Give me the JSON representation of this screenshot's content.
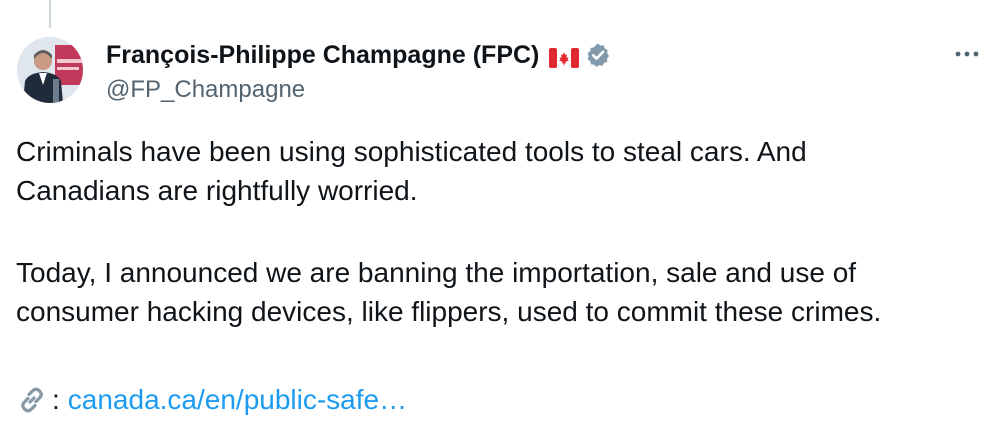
{
  "tweet": {
    "author": {
      "name": "François-Philippe Champagne (FPC)",
      "handle": "@FP_Champagne",
      "flag_icon": "canada-flag-icon",
      "verified_icon": "verified-badge-icon",
      "verified_color": "#829aab"
    },
    "more_icon": "more-horizontal-icon",
    "paragraph1_line1": "Criminals have been using sophisticated tools to steal cars. And",
    "paragraph1_line2": "Canadians are rightfully worried.",
    "paragraph2_line1": "Today, I announced we are banning the importation, sale and use of",
    "paragraph2_line2": "consumer hacking devices, like flippers, used to commit these crimes.",
    "link": {
      "icon": "link-icon",
      "colon": ":",
      "text": "canada.ca/en/public-safe…"
    }
  },
  "colors": {
    "text": "#0f1419",
    "secondary": "#536471",
    "link": "#1d9bf0"
  }
}
